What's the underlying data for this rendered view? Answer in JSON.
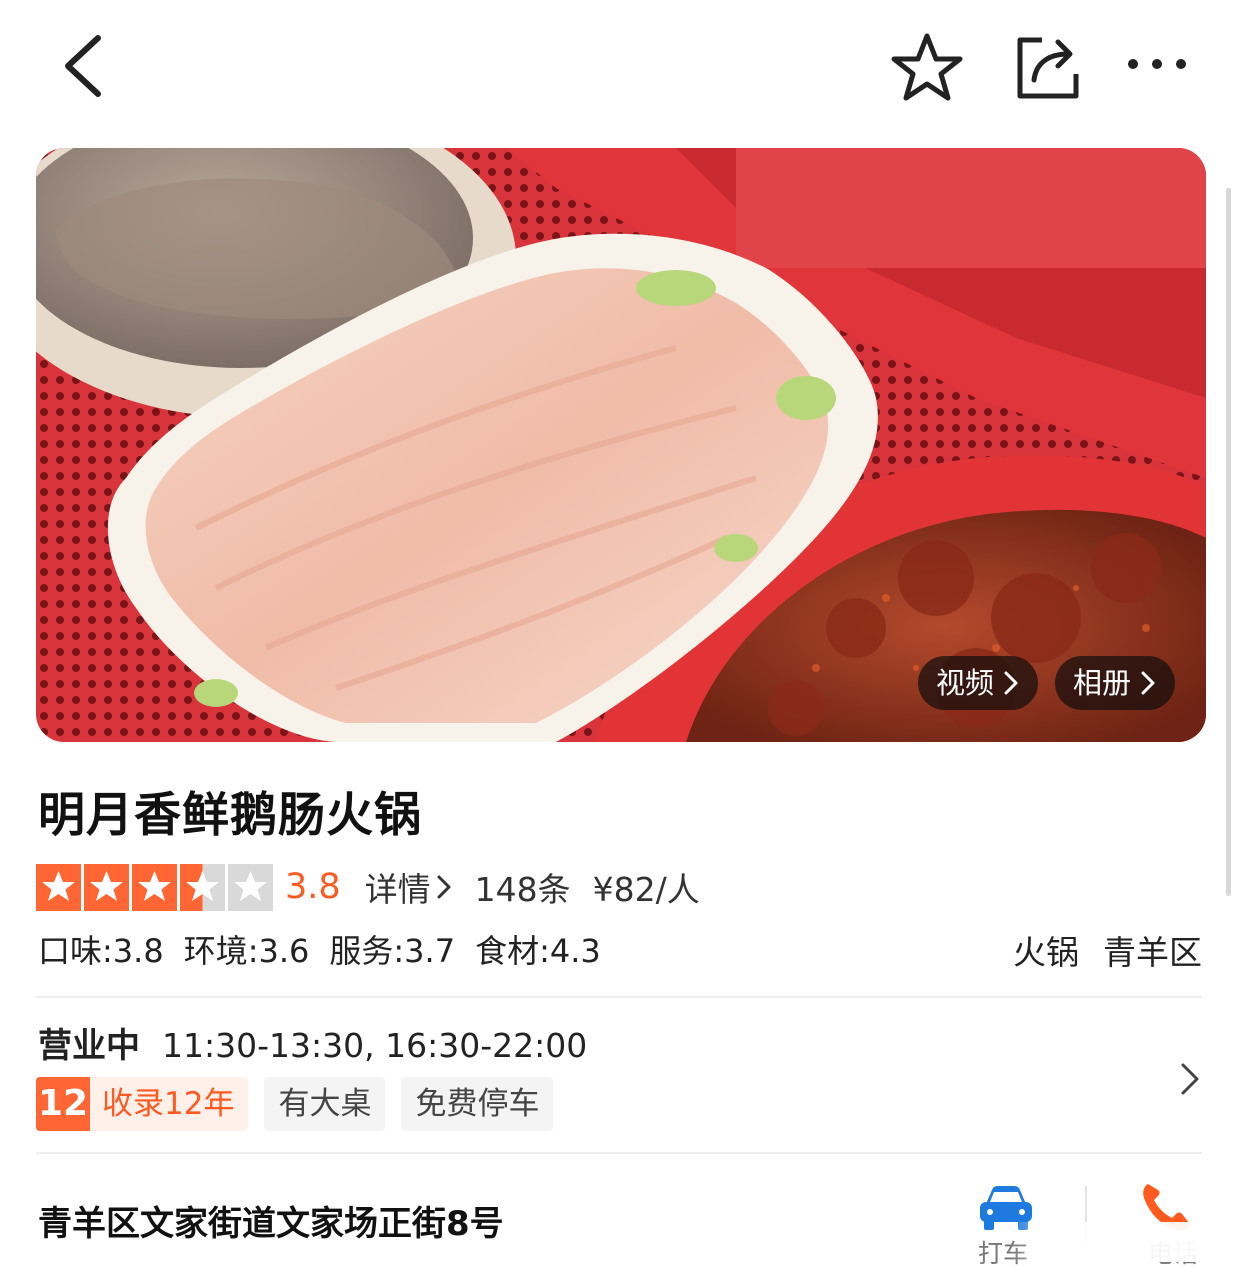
{
  "header": {
    "back_icon": "chevron-left-icon",
    "favorite_icon": "star-outline-icon",
    "share_icon": "share-icon",
    "more_icon": "more-horizontal-icon"
  },
  "hero": {
    "video_label": "视频",
    "album_label": "相册"
  },
  "shop": {
    "name": "明月香鲜鹅肠火锅",
    "rating_stars": 3.5,
    "score": "3.8",
    "detail_label": "详情",
    "review_count": "148条",
    "price_per_person": "¥82/人",
    "sub_scores": [
      {
        "label": "口味:3.8"
      },
      {
        "label": "环境:3.6"
      },
      {
        "label": "服务:3.7"
      },
      {
        "label": "食材:4.3"
      }
    ],
    "category": "火锅",
    "district": "青羊区"
  },
  "hours": {
    "status": "营业中",
    "times": "11:30-13:30, 16:30-22:00"
  },
  "chips": {
    "years_number": "12",
    "years_text": "收录12年",
    "items": [
      "有大桌",
      "免费停车"
    ]
  },
  "address": {
    "text": "青羊区文家街道文家场正街8号",
    "taxi_label": "打车",
    "phone_label": "电话"
  },
  "colors": {
    "accent": "#ff5a1f",
    "star_on": "#ff6633",
    "star_off": "#d9d9d9"
  }
}
